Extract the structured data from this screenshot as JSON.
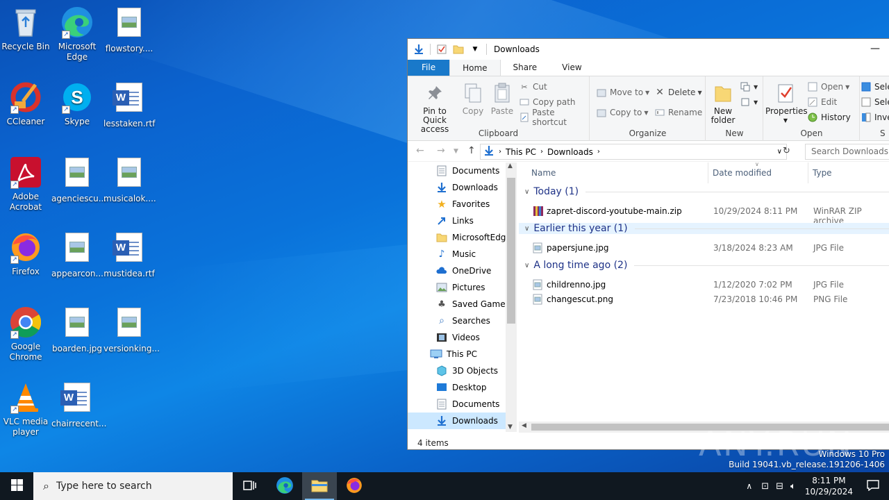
{
  "desktop": {
    "icons": [
      {
        "label": "Recycle Bin",
        "icon": "recycle-bin-icon"
      },
      {
        "label": "Microsoft Edge",
        "icon": "edge-icon"
      },
      {
        "label": "flowstory....",
        "icon": "image-file-icon"
      },
      {
        "label": "CCleaner",
        "icon": "ccleaner-icon"
      },
      {
        "label": "Skype",
        "icon": "skype-icon"
      },
      {
        "label": "lesstaken.rtf",
        "icon": "word-document-icon"
      },
      {
        "label": "Adobe Acrobat",
        "icon": "acrobat-icon"
      },
      {
        "label": "agenciescu...",
        "icon": "image-file-icon"
      },
      {
        "label": "musicalok....",
        "icon": "image-file-icon"
      },
      {
        "label": "Firefox",
        "icon": "firefox-icon"
      },
      {
        "label": "appearcon...",
        "icon": "image-file-icon"
      },
      {
        "label": "mustidea.rtf",
        "icon": "word-document-icon"
      },
      {
        "label": "Google Chrome",
        "icon": "chrome-icon"
      },
      {
        "label": "boarden.jpg",
        "icon": "image-file-icon"
      },
      {
        "label": "versionking...",
        "icon": "image-file-icon"
      },
      {
        "label": "VLC media player",
        "icon": "vlc-icon"
      },
      {
        "label": "chairrecent...",
        "icon": "word-document-icon"
      }
    ]
  },
  "explorer": {
    "title": "Downloads",
    "tabs": [
      "File",
      "Home",
      "Share",
      "View"
    ],
    "ribbon": {
      "clipboard": {
        "label": "Clipboard",
        "pin": "Pin to Quick access",
        "copy": "Copy",
        "paste": "Paste",
        "cut": "Cut",
        "copy_path": "Copy path",
        "paste_shortcut": "Paste shortcut"
      },
      "organize": {
        "label": "Organize",
        "move_to": "Move to",
        "copy_to": "Copy to",
        "delete": "Delete",
        "rename": "Rename"
      },
      "new": {
        "label": "New",
        "new_folder": "New folder"
      },
      "open": {
        "label": "Open",
        "properties": "Properties",
        "open": "Open",
        "edit": "Edit",
        "history": "History"
      },
      "select": {
        "label": "S",
        "select_all": "Selec",
        "select_none": "Selec",
        "invert": "Inver"
      }
    },
    "address": {
      "path": [
        "This PC",
        "Downloads"
      ],
      "search_placeholder": "Search Downloads"
    },
    "nav": [
      {
        "label": "Documents",
        "icon": "documents-icon",
        "indent": 1
      },
      {
        "label": "Downloads",
        "icon": "downloads-icon",
        "indent": 1
      },
      {
        "label": "Favorites",
        "icon": "favorites-star-icon",
        "indent": 1
      },
      {
        "label": "Links",
        "icon": "links-icon",
        "indent": 1
      },
      {
        "label": "MicrosoftEdge",
        "icon": "folder-icon",
        "indent": 1
      },
      {
        "label": "Music",
        "icon": "music-icon",
        "indent": 1
      },
      {
        "label": "OneDrive",
        "icon": "onedrive-icon",
        "indent": 1
      },
      {
        "label": "Pictures",
        "icon": "pictures-icon",
        "indent": 1
      },
      {
        "label": "Saved Games",
        "icon": "saved-games-icon",
        "indent": 1
      },
      {
        "label": "Searches",
        "icon": "searches-icon",
        "indent": 1
      },
      {
        "label": "Videos",
        "icon": "videos-icon",
        "indent": 1
      },
      {
        "label": "This PC",
        "icon": "this-pc-icon",
        "indent": 0
      },
      {
        "label": "3D Objects",
        "icon": "3d-objects-icon",
        "indent": 1
      },
      {
        "label": "Desktop",
        "icon": "desktop-icon",
        "indent": 1
      },
      {
        "label": "Documents",
        "icon": "documents-icon",
        "indent": 1
      },
      {
        "label": "Downloads",
        "icon": "downloads-icon",
        "indent": 1,
        "selected": true
      }
    ],
    "columns": {
      "name": "Name",
      "date": "Date modified",
      "type": "Type"
    },
    "groups": [
      {
        "title": "Today (1)",
        "files": [
          {
            "name": "zapret-discord-youtube-main.zip",
            "date": "10/29/2024 8:11 PM",
            "type": "WinRAR ZIP archive",
            "icon": "winrar-archive-icon"
          }
        ]
      },
      {
        "title": "Earlier this year (1)",
        "files": [
          {
            "name": "papersjune.jpg",
            "date": "3/18/2024 8:23 AM",
            "type": "JPG File",
            "icon": "image-file-icon"
          }
        ]
      },
      {
        "title": "A long time ago (2)",
        "files": [
          {
            "name": "childrenno.jpg",
            "date": "1/12/2020 7:02 PM",
            "type": "JPG File",
            "icon": "image-file-icon"
          },
          {
            "name": "changescut.png",
            "date": "7/23/2018 10:46 PM",
            "type": "PNG File",
            "icon": "image-file-icon"
          }
        ]
      }
    ],
    "status": "4 items"
  },
  "watermark": {
    "logo": "ANY.RUN",
    "edition": "Windows 10 Pro",
    "build": "Build 19041.vb_release.191206-1406"
  },
  "taskbar": {
    "search_placeholder": "Type here to search",
    "time": "8:11 PM",
    "date": "10/29/2024"
  }
}
